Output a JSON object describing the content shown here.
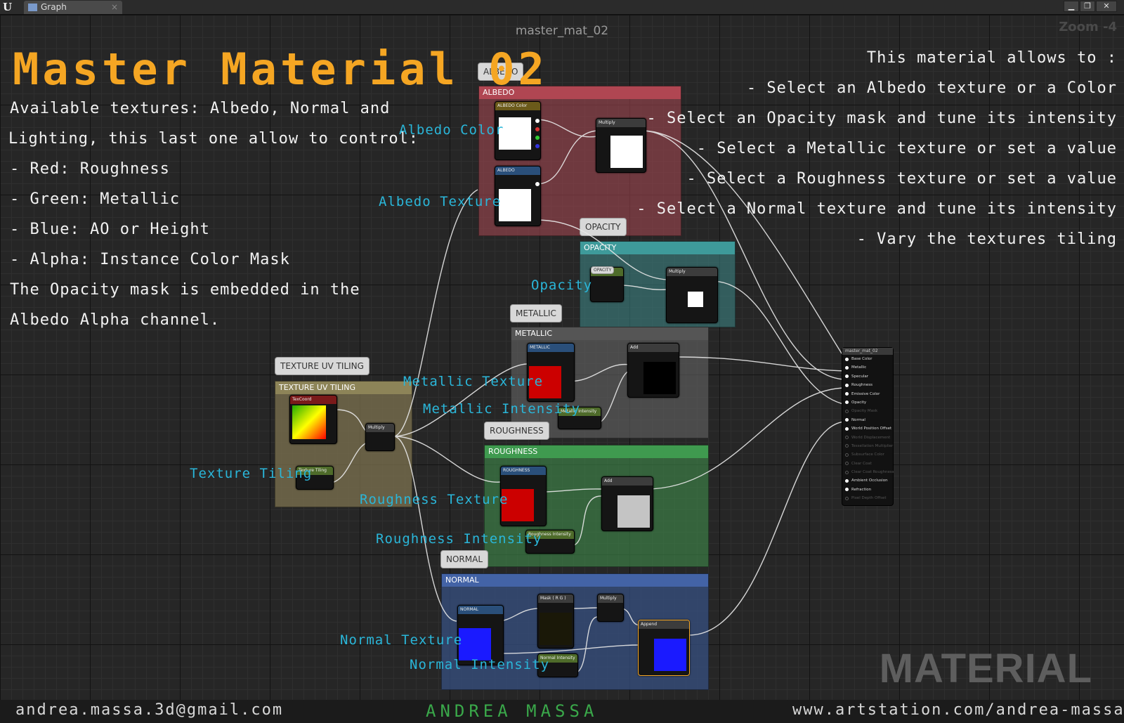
{
  "window": {
    "tab_label": "Graph",
    "tab_close": "×",
    "minimize": "▁",
    "restore": "❐",
    "close": "✕"
  },
  "graph": {
    "title": "master_mat_02",
    "zoom": "Zoom -4"
  },
  "heading": "Master Material 02",
  "left_description": [
    "Available textures: Albedo, Normal and",
    "Lighting, this last one allow to control:",
    "- Red:  Roughness",
    "- Green: Metallic",
    "- Blue: AO or Height",
    "- Alpha: Instance Color Mask",
    "The Opacity mask is embedded in the",
    "Albedo Alpha channel."
  ],
  "right_description": [
    "This material allows to :",
    "- Select an Albedo texture or a Color",
    "- Select an Opacity mask and tune its intensity",
    "- Select a Metallic texture or set a value",
    "- Select a Roughness texture or set a value",
    "- Select a Normal texture and tune its intensity",
    "- Vary the textures tiling"
  ],
  "comments": {
    "albedo": "ALBEDO",
    "opacity": "OPACITY",
    "metallic": "METALLIC",
    "roughness": "ROUGHNESS",
    "normal": "NORMAL",
    "tiling": "TEXTURE UV TILING"
  },
  "labels": {
    "albedo_color": "Albedo Color",
    "albedo_texture": "Albedo Texture",
    "opacity": "Opacity",
    "metallic_texture": "Metallic Texture",
    "metallic_intensity": "Metallic Intensity",
    "texture_tiling": "Texture Tiling",
    "roughness_texture": "Roughness Texture",
    "roughness_intensity": "Roughness Intensity",
    "normal_texture": "Normal Texture",
    "normal_intensity": "Normal Intensity"
  },
  "nodes": {
    "albedo_color": "ALBEDO Color",
    "albedo_tex": "ALBEDO",
    "albedo_mult": "Multiply",
    "opacity_param": "OPACITY",
    "opacity_scalar": "Opacity",
    "opacity_mult": "Multiply",
    "metallic_tex": "METALLIC",
    "metallic_int": "Metallic Intensity",
    "metallic_add": "Add",
    "texcoord": "TexCoord",
    "tiling": "Texture Tiling",
    "tiling_mult": "Multiply",
    "roughness_tex": "ROUGHNESS",
    "roughness_int": "Roughness Intensity",
    "roughness_add": "Add",
    "normal_tex": "NORMAL",
    "normal_mask": "Mask ( R G )",
    "normal_mult": "Multiply",
    "normal_int": "Normal Intensity",
    "normal_append": "Append"
  },
  "result_node": {
    "title": "master_mat_02",
    "pins": [
      {
        "label": "Base Color",
        "active": true
      },
      {
        "label": "Metallic",
        "active": true
      },
      {
        "label": "Specular",
        "active": true
      },
      {
        "label": "Roughness",
        "active": true
      },
      {
        "label": "Emissive Color",
        "active": true
      },
      {
        "label": "Opacity",
        "active": true
      },
      {
        "label": "Opacity Mask",
        "active": false
      },
      {
        "label": "Normal",
        "active": true
      },
      {
        "label": "World Position Offset",
        "active": true
      },
      {
        "label": "World Displacement",
        "active": false
      },
      {
        "label": "Tessellation Multiplier",
        "active": false
      },
      {
        "label": "Subsurface Color",
        "active": false
      },
      {
        "label": "Clear Coat",
        "active": false
      },
      {
        "label": "Clear Coat Roughness",
        "active": false
      },
      {
        "label": "Ambient Occlusion",
        "active": true
      },
      {
        "label": "Refraction",
        "active": true
      },
      {
        "label": "Pixel Depth Offset",
        "active": false
      }
    ]
  },
  "watermark": "MATERIAL",
  "footer": {
    "email": "andrea.massa.3d@gmail.com",
    "name": "ANDREA MASSA",
    "website": "www.artstation.com/andrea-massa"
  }
}
